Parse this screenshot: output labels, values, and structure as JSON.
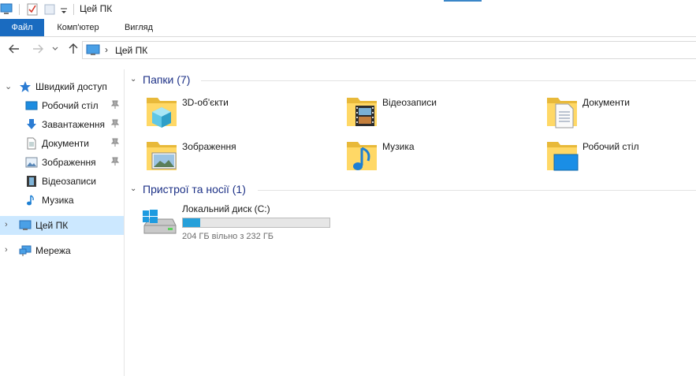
{
  "window": {
    "title": "Цей ПК"
  },
  "ribbon": {
    "tabs": [
      "Файл",
      "Комп'ютер",
      "Вигляд"
    ]
  },
  "address": {
    "crumb": "Цей ПК"
  },
  "sidebar": {
    "quick_access": "Швидкий доступ",
    "pinned": [
      {
        "label": "Робочий стіл",
        "icon": "desktop-icon",
        "pinned": true
      },
      {
        "label": "Завантаження",
        "icon": "download-icon",
        "pinned": true
      },
      {
        "label": "Документи",
        "icon": "documents-icon",
        "pinned": true
      },
      {
        "label": "Зображення",
        "icon": "pictures-icon",
        "pinned": true
      },
      {
        "label": "Відеозаписи",
        "icon": "videos-icon",
        "pinned": false
      },
      {
        "label": "Музика",
        "icon": "music-icon",
        "pinned": false
      }
    ],
    "this_pc": "Цей ПК",
    "network": "Мережа"
  },
  "main": {
    "folders_group": "Папки (7)",
    "folders": [
      {
        "label": "3D-об'єкти",
        "icon": "3d-objects-icon"
      },
      {
        "label": "Відеозаписи",
        "icon": "videos-icon"
      },
      {
        "label": "Документи",
        "icon": "documents-icon"
      },
      {
        "label": "Зображення",
        "icon": "pictures-icon"
      },
      {
        "label": "Музика",
        "icon": "music-icon"
      },
      {
        "label": "Робочий стіл",
        "icon": "desktop-icon"
      }
    ],
    "devices_group": "Пристрої та носії (1)",
    "drive": {
      "name": "Локальний диск (C:)",
      "free_text": "204 ГБ вільно з 232 ГБ",
      "used_fraction": 0.12
    }
  },
  "colors": {
    "accent": "#1a6bc0",
    "selected": "#cce8ff",
    "group_title": "#1e3287",
    "drive_bar": "#26a0da"
  }
}
